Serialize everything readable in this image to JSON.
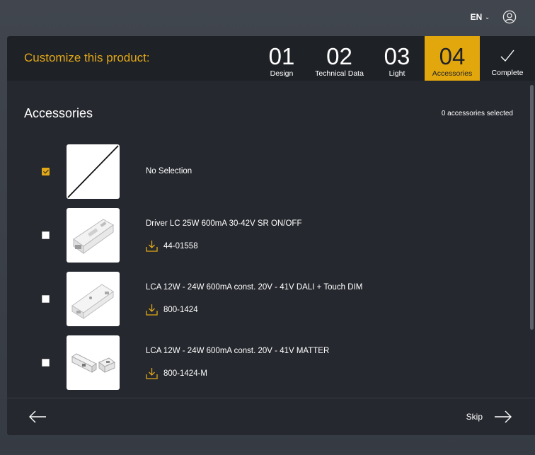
{
  "topbar": {
    "language": "EN"
  },
  "header": {
    "title": "Customize this product:",
    "steps": [
      {
        "num": "01",
        "label": "Design"
      },
      {
        "num": "02",
        "label": "Technical Data"
      },
      {
        "num": "03",
        "label": "Light"
      },
      {
        "num": "04",
        "label": "Accessories",
        "active": true
      },
      {
        "label": "Complete",
        "icon": "checkmark-icon"
      }
    ]
  },
  "section": {
    "title": "Accessories",
    "selected_count": "0 accessories selected"
  },
  "items": [
    {
      "name": "No Selection",
      "checked": true
    },
    {
      "name": "Driver LC 25W 600mA 30-42V SR ON/OFF",
      "code": "44-01558",
      "checked": false
    },
    {
      "name": "LCA 12W - 24W 600mA const. 20V - 41V DALI + Touch DIM",
      "code": "800-1424",
      "checked": false
    },
    {
      "name": "LCA 12W - 24W 600mA const. 20V - 41V MATTER",
      "code": "800-1424-M",
      "checked": false
    }
  ],
  "footer": {
    "skip_label": "Skip"
  },
  "colors": {
    "accent": "#e3a70e",
    "panel": "#25282e",
    "header": "#1e2126"
  }
}
